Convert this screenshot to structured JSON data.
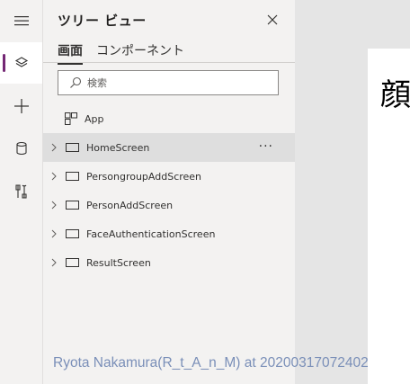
{
  "rail": {
    "items": [
      {
        "icon": "hamburger-menu-icon"
      },
      {
        "icon": "layers-icon",
        "active": true
      },
      {
        "icon": "plus-icon"
      },
      {
        "icon": "database-icon"
      },
      {
        "icon": "tools-icon"
      }
    ]
  },
  "tree_panel": {
    "title": "ツリー ビュー",
    "tabs": [
      {
        "label": "画面",
        "selected": true
      },
      {
        "label": "コンポーネント",
        "selected": false
      }
    ],
    "search": {
      "placeholder": "検索",
      "value": ""
    },
    "app_item": {
      "label": "App"
    },
    "screens": [
      {
        "label": "HomeScreen",
        "selected": true
      },
      {
        "label": "PersongroupAddScreen",
        "selected": false
      },
      {
        "label": "PersonAddScreen",
        "selected": false
      },
      {
        "label": "FaceAuthenticationScreen",
        "selected": false
      },
      {
        "label": "ResultScreen",
        "selected": false
      }
    ],
    "more_label": "···"
  },
  "canvas": {
    "title": "顔"
  },
  "watermark": "Ryota Nakamura(R_t_A_n_M) at 20200317072402",
  "colors": {
    "accent": "#742774",
    "panel_bg": "#f3f2f1",
    "selected_row": "#dedede",
    "canvas_bg": "#e5e5e5"
  }
}
